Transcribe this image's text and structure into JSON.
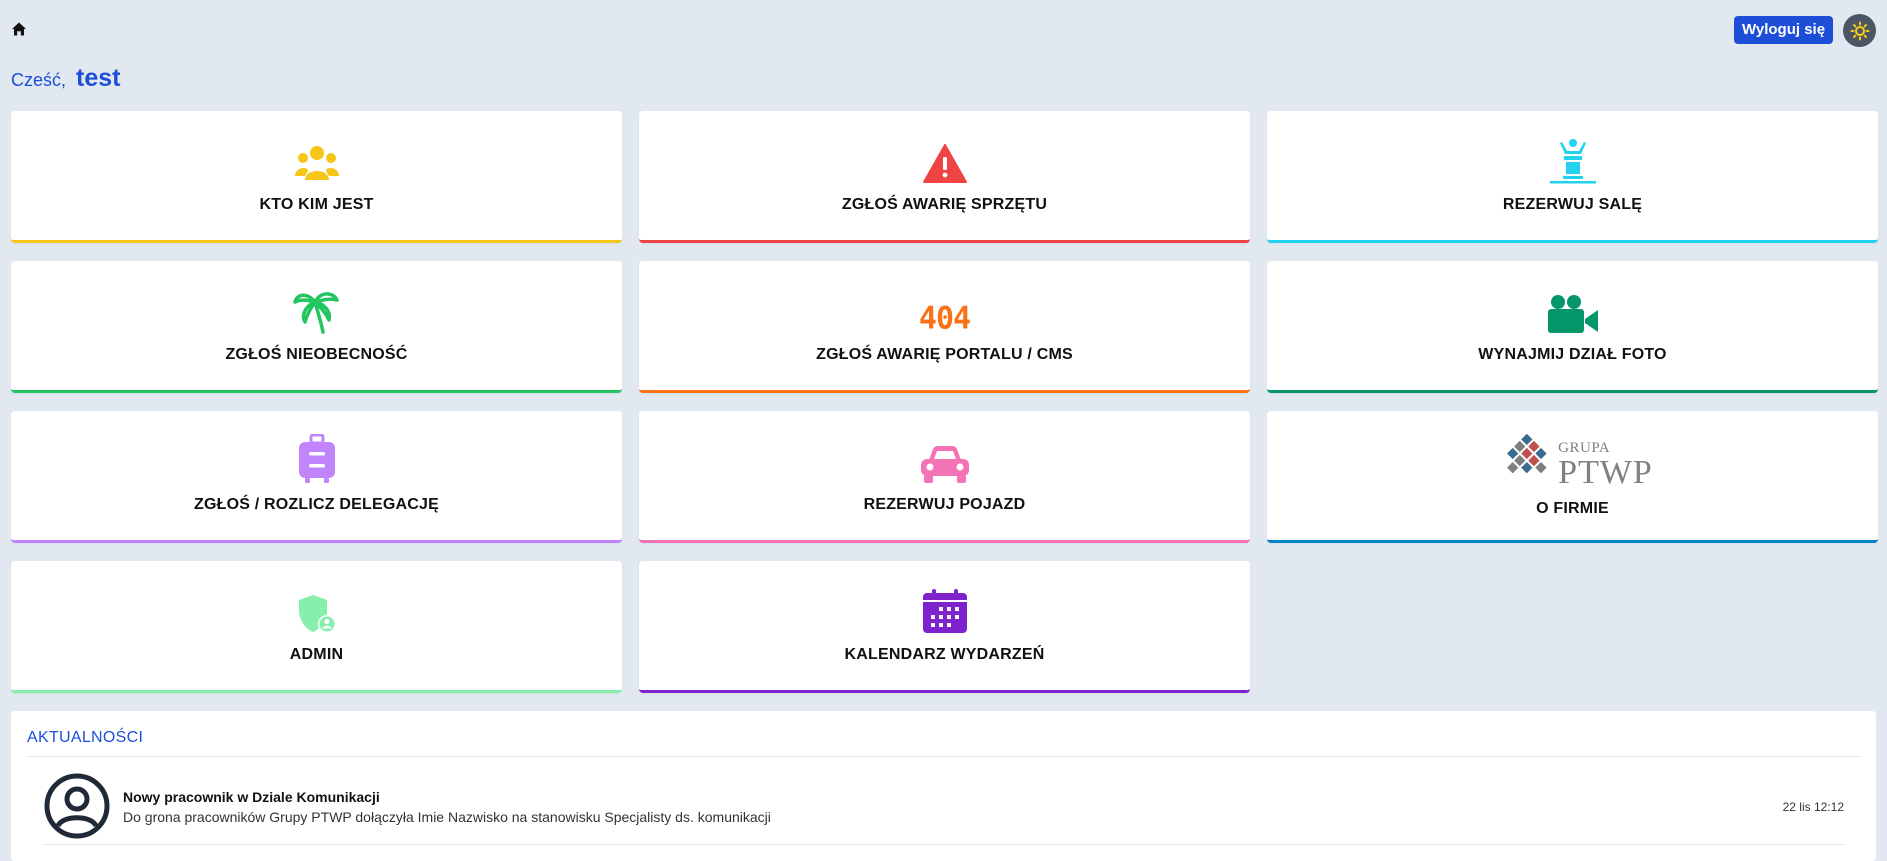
{
  "header": {
    "home_icon": "home-icon",
    "logout_label": "Wyloguj się",
    "theme_icon": "sun-icon"
  },
  "greeting": {
    "hello": "Cześć,",
    "user": "test"
  },
  "tiles": [
    {
      "label": "KTO KIM JEST",
      "icon": "people-group-icon",
      "color": "#f5c518"
    },
    {
      "label": "ZGŁOŚ AWARIĘ SPRZĘTU",
      "icon": "warning-triangle-icon",
      "color": "#ef4444"
    },
    {
      "label": "REZERWUJ SALĘ",
      "icon": "person-podium-icon",
      "color": "#22d3ee"
    },
    {
      "label": "ZGŁOŚ NIEOBECNOŚĆ",
      "icon": "palm-tree-icon",
      "color": "#22c55e"
    },
    {
      "label": "ZGŁOŚ AWARIĘ PORTALU / CMS",
      "icon": "404-icon",
      "icon_text": "404",
      "color": "#f97316"
    },
    {
      "label": "WYNAJMIJ DZIAŁ FOTO",
      "icon": "video-camera-icon",
      "color": "#059669"
    },
    {
      "label": "ZGŁOŚ / ROZLICZ DELEGACJĘ",
      "icon": "suitcase-icon",
      "color": "#c084fc"
    },
    {
      "label": "REZERWUJ POJAZD",
      "icon": "car-icon",
      "color": "#f472b6"
    },
    {
      "label": "O FIRMIE",
      "icon": "grupa-ptwp-logo",
      "logo_small": "GRUPA",
      "logo_big": "PTWP",
      "color": "#0284c7"
    },
    {
      "label": "ADMIN",
      "icon": "shield-user-icon",
      "color": "#86efac"
    },
    {
      "label": "KALENDARZ WYDARZEŃ",
      "icon": "calendar-icon",
      "color": "#7e22ce"
    }
  ],
  "news": {
    "heading": "AKTUALNOŚCI",
    "items": [
      {
        "title": "Nowy pracownik w Dziale Komunikacji",
        "body": "Do grona pracowników Grupy PTWP dołączyła Imie Nazwisko na stanowisku Specjalisty ds. komunikacji",
        "time": "22 lis 12:12",
        "avatar_icon": "user-circle-icon"
      }
    ]
  }
}
